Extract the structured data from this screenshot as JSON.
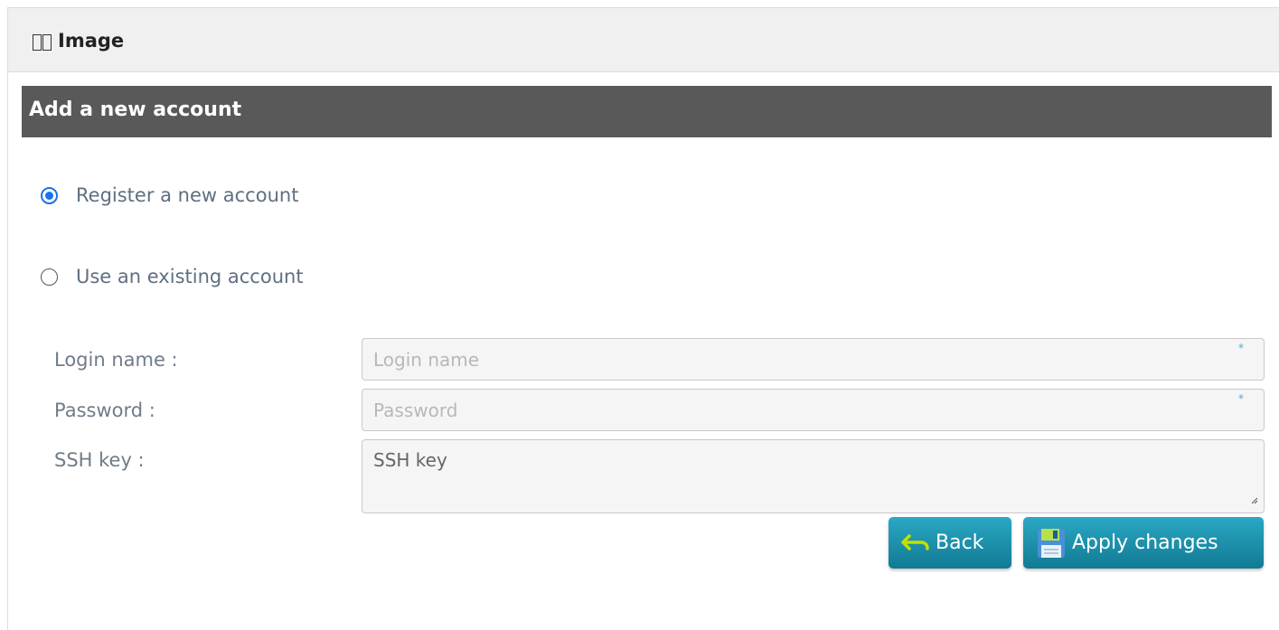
{
  "header": {
    "title": "Image"
  },
  "section": {
    "title": "Add a new account"
  },
  "radios": {
    "register": {
      "label": "Register a new account",
      "checked": true
    },
    "existing": {
      "label": "Use an existing account",
      "checked": false
    }
  },
  "form": {
    "login": {
      "label": "Login name :",
      "placeholder": "Login name",
      "value": "",
      "required": "*"
    },
    "password": {
      "label": "Password :",
      "placeholder": "Password",
      "value": "",
      "required": "*"
    },
    "ssh": {
      "label": "SSH key :",
      "placeholder": "SSH key",
      "value": ""
    }
  },
  "buttons": {
    "back": {
      "label": "Back"
    },
    "apply": {
      "label": "Apply changes"
    }
  },
  "colors": {
    "accent": "#1a73e8",
    "button": "#1a8fab",
    "section_bar": "#595959",
    "back_icon": "#c4e000"
  },
  "icons": {
    "header": "box-icon",
    "back": "back-arrow-icon",
    "apply": "save-icon"
  }
}
